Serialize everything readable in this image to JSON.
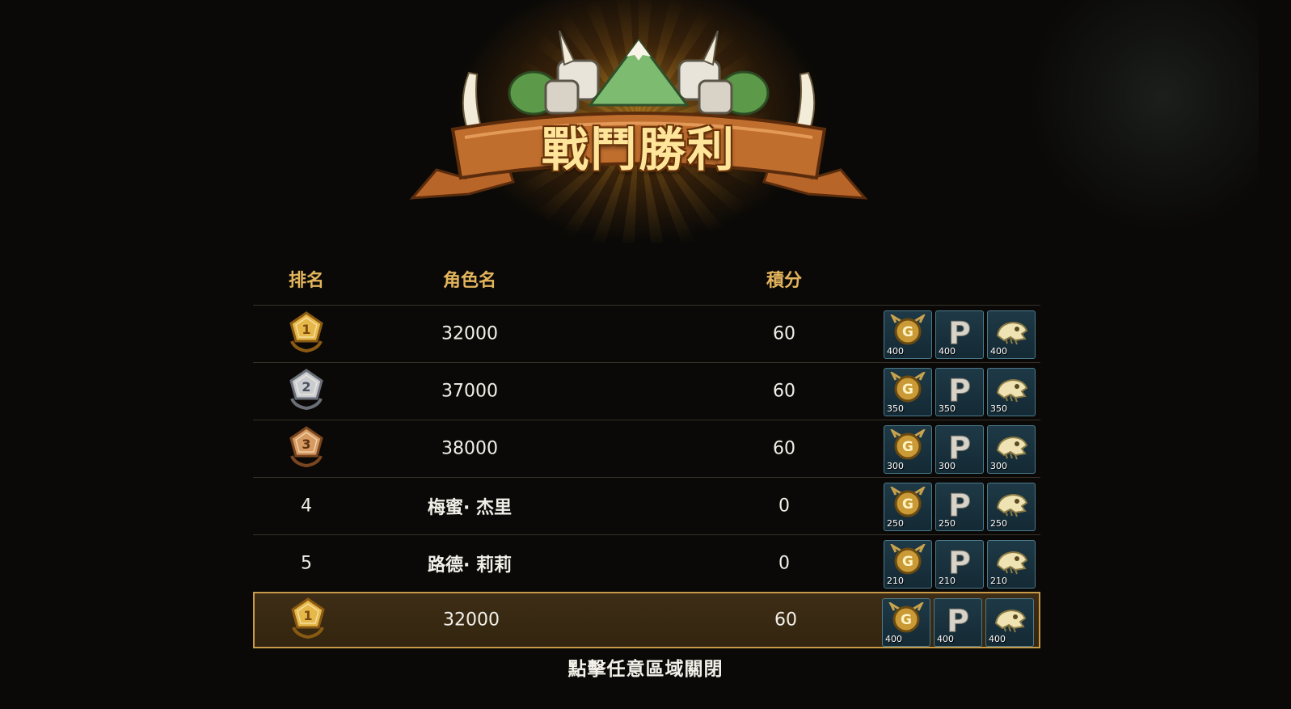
{
  "banner": {
    "title": "戰鬥勝利"
  },
  "table": {
    "headers": {
      "rank": "排名",
      "name": "角色名",
      "score": "積分"
    },
    "rows": [
      {
        "rank": "1",
        "medal": "gold",
        "name": "32000",
        "score": "60",
        "rewards": [
          {
            "icon": "gold-coin-icon",
            "amount": "400"
          },
          {
            "icon": "p-point-icon",
            "amount": "400"
          },
          {
            "icon": "fossil-skull-icon",
            "amount": "400"
          }
        ]
      },
      {
        "rank": "2",
        "medal": "silver",
        "name": "37000",
        "score": "60",
        "rewards": [
          {
            "icon": "gold-coin-icon",
            "amount": "350"
          },
          {
            "icon": "p-point-icon",
            "amount": "350"
          },
          {
            "icon": "fossil-skull-icon",
            "amount": "350"
          }
        ]
      },
      {
        "rank": "3",
        "medal": "bronze",
        "name": "38000",
        "score": "60",
        "rewards": [
          {
            "icon": "gold-coin-icon",
            "amount": "300"
          },
          {
            "icon": "p-point-icon",
            "amount": "300"
          },
          {
            "icon": "fossil-skull-icon",
            "amount": "300"
          }
        ]
      },
      {
        "rank": "4",
        "medal": "",
        "name": "梅蜜· 杰里",
        "score": "0",
        "rewards": [
          {
            "icon": "gold-coin-icon",
            "amount": "250"
          },
          {
            "icon": "p-point-icon",
            "amount": "250"
          },
          {
            "icon": "fossil-skull-icon",
            "amount": "250"
          }
        ]
      },
      {
        "rank": "5",
        "medal": "",
        "name": "路德· 莉莉",
        "score": "0",
        "rewards": [
          {
            "icon": "gold-coin-icon",
            "amount": "210"
          },
          {
            "icon": "p-point-icon",
            "amount": "210"
          },
          {
            "icon": "fossil-skull-icon",
            "amount": "210"
          }
        ]
      },
      {
        "rank": "1",
        "medal": "gold",
        "name": "32000",
        "score": "60",
        "self": true,
        "rewards": [
          {
            "icon": "gold-coin-icon",
            "amount": "400"
          },
          {
            "icon": "p-point-icon",
            "amount": "400"
          },
          {
            "icon": "fossil-skull-icon",
            "amount": "400"
          }
        ]
      }
    ]
  },
  "footer": {
    "close_hint": "點擊任意區域關閉"
  },
  "colors": {
    "header_gold": "#e2b45c",
    "self_row_border": "#c79a4a",
    "reward_bg": "#1e3946"
  }
}
